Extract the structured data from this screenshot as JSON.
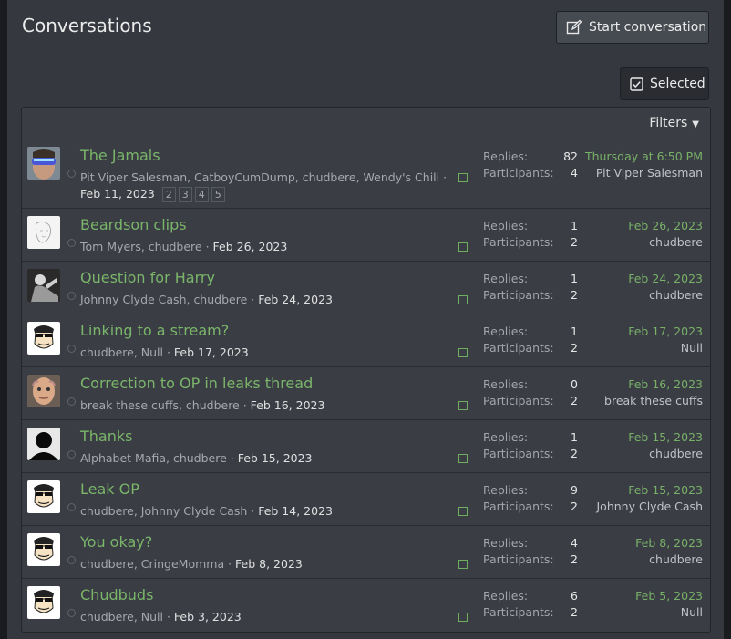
{
  "header": {
    "title": "Conversations",
    "start_label": "Start conversation",
    "selected_label": "Selected"
  },
  "filters": {
    "label": "Filters"
  },
  "conversations": [
    {
      "title": "The Jamals",
      "participants_text": "Pit Viper Salesman, CatboyCumDump, chudbere, Wendy's Chili",
      "date": "Feb 11, 2023",
      "pages": [
        "2",
        "3",
        "4",
        "5"
      ],
      "replies_label": "Replies:",
      "replies": "82",
      "participants_label": "Participants:",
      "participants_count": "4",
      "last_when": "Thursday at 6:50 PM",
      "last_who": "Pit Viper Salesman",
      "avatar": "sunglasses-man"
    },
    {
      "title": "Beardson clips",
      "participants_text": "Tom Myers, chudbere",
      "date": "Feb 26, 2023",
      "replies_label": "Replies:",
      "replies": "1",
      "participants_label": "Participants:",
      "participants_count": "2",
      "last_when": "Feb 26, 2023",
      "last_who": "chudbere",
      "avatar": "sketch"
    },
    {
      "title": "Question for Harry",
      "participants_text": "Johnny Clyde Cash, chudbere",
      "date": "Feb 24, 2023",
      "replies_label": "Replies:",
      "replies": "1",
      "participants_label": "Participants:",
      "participants_count": "2",
      "last_when": "Feb 24, 2023",
      "last_who": "chudbere",
      "avatar": "bw-photo"
    },
    {
      "title": "Linking to a stream?",
      "participants_text": "chudbere, Null",
      "date": "Feb 17, 2023",
      "replies_label": "Replies:",
      "replies": "1",
      "participants_label": "Participants:",
      "participants_count": "2",
      "last_when": "Feb 17, 2023",
      "last_who": "Null",
      "avatar": "cartoon-face"
    },
    {
      "title": "Correction to OP in leaks thread",
      "participants_text": "break these cuffs, chudbere",
      "date": "Feb 16, 2023",
      "replies_label": "Replies:",
      "replies": "0",
      "participants_label": "Participants:",
      "participants_count": "2",
      "last_when": "Feb 16, 2023",
      "last_who": "break these cuffs",
      "avatar": "bald-man"
    },
    {
      "title": "Thanks",
      "participants_text": "Alphabet Mafia, chudbere",
      "date": "Feb 15, 2023",
      "replies_label": "Replies:",
      "replies": "1",
      "participants_label": "Participants:",
      "participants_count": "2",
      "last_when": "Feb 15, 2023",
      "last_who": "chudbere",
      "avatar": "silhouette"
    },
    {
      "title": "Leak OP",
      "participants_text": "chudbere, Johnny Clyde Cash",
      "date": "Feb 14, 2023",
      "replies_label": "Replies:",
      "replies": "9",
      "participants_label": "Participants:",
      "participants_count": "2",
      "last_when": "Feb 15, 2023",
      "last_who": "Johnny Clyde Cash",
      "avatar": "cartoon-face"
    },
    {
      "title": "You okay?",
      "participants_text": "chudbere, CringeMomma",
      "date": "Feb 8, 2023",
      "replies_label": "Replies:",
      "replies": "4",
      "participants_label": "Participants:",
      "participants_count": "2",
      "last_when": "Feb 8, 2023",
      "last_who": "chudbere",
      "avatar": "cartoon-face"
    },
    {
      "title": "Chudbuds",
      "participants_text": "chudbere, Null",
      "date": "Feb 3, 2023",
      "replies_label": "Replies:",
      "replies": "6",
      "participants_label": "Participants:",
      "participants_count": "2",
      "last_when": "Feb 5, 2023",
      "last_who": "Null",
      "avatar": "cartoon-face"
    }
  ],
  "colors": {
    "accent_green": "#7ab56a",
    "panel": "#3a3d44",
    "background": "#35383f"
  },
  "icons": {
    "start": "edit-icon",
    "selected": "checkbox-icon",
    "filters": "caret-down-icon"
  }
}
